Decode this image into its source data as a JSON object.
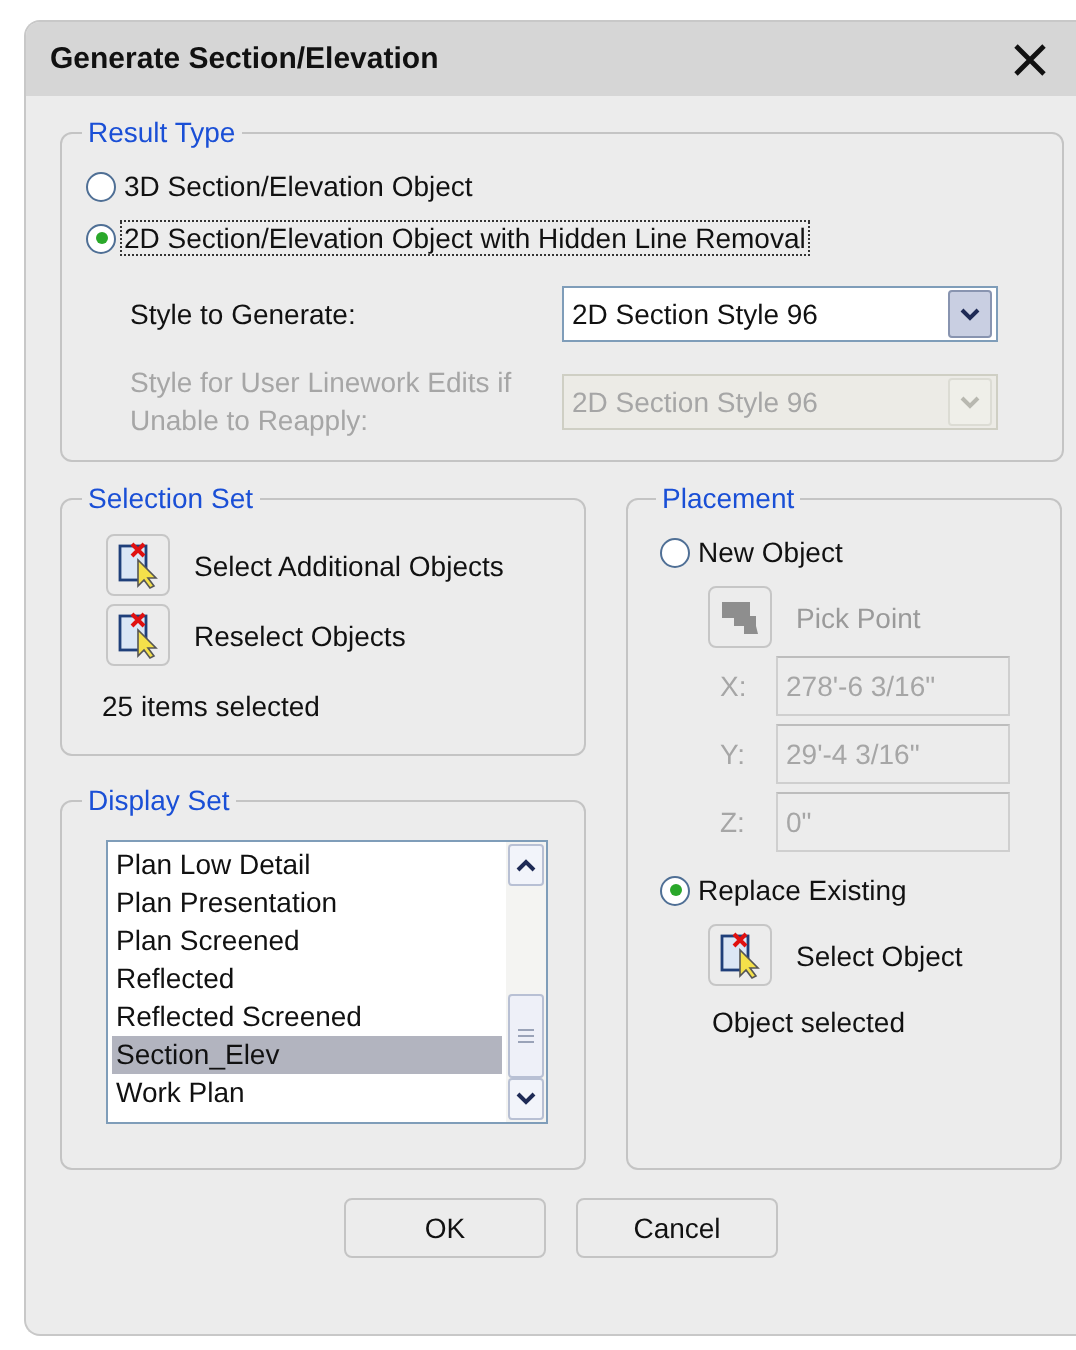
{
  "window": {
    "title": "Generate Section/Elevation"
  },
  "result_type": {
    "legend": "Result Type",
    "options": [
      {
        "label": "3D Section/Elevation Object",
        "selected": false
      },
      {
        "label": "2D Section/Elevation Object with Hidden Line Removal",
        "selected": true
      }
    ],
    "styles": [
      {
        "label": "Style to Generate:",
        "value": "2D Section Style 96",
        "disabled": false
      },
      {
        "label": "Style for User Linework Edits if Unable to Reapply:",
        "value": "2D Section Style 96",
        "disabled": true
      }
    ]
  },
  "selection_set": {
    "legend": "Selection Set",
    "buttons": [
      {
        "label": "Select Additional Objects"
      },
      {
        "label": "Reselect Objects"
      }
    ],
    "status": "25 items selected"
  },
  "display_set": {
    "legend": "Display Set",
    "items": [
      {
        "label": "Plan Low Detail",
        "selected": false
      },
      {
        "label": "Plan Presentation",
        "selected": false
      },
      {
        "label": "Plan Screened",
        "selected": false
      },
      {
        "label": "Reflected",
        "selected": false
      },
      {
        "label": "Reflected Screened",
        "selected": false
      },
      {
        "label": "Section_Elev",
        "selected": true
      },
      {
        "label": "Work Plan",
        "selected": false
      }
    ]
  },
  "placement": {
    "legend": "Placement",
    "new_object": {
      "label": "New Object",
      "selected": false
    },
    "pick_point": {
      "label": "Pick Point",
      "disabled": true
    },
    "coordinates": [
      {
        "label": "X:",
        "value": "278'-6 3/16\"",
        "disabled": true
      },
      {
        "label": "Y:",
        "value": "29'-4 3/16\"",
        "disabled": true
      },
      {
        "label": "Z:",
        "value": "0\"",
        "disabled": true
      }
    ],
    "replace_existing": {
      "label": "Replace Existing",
      "selected": true
    },
    "select_object": {
      "label": "Select Object"
    },
    "status": "Object selected"
  },
  "buttons": [
    "OK",
    "Cancel"
  ]
}
